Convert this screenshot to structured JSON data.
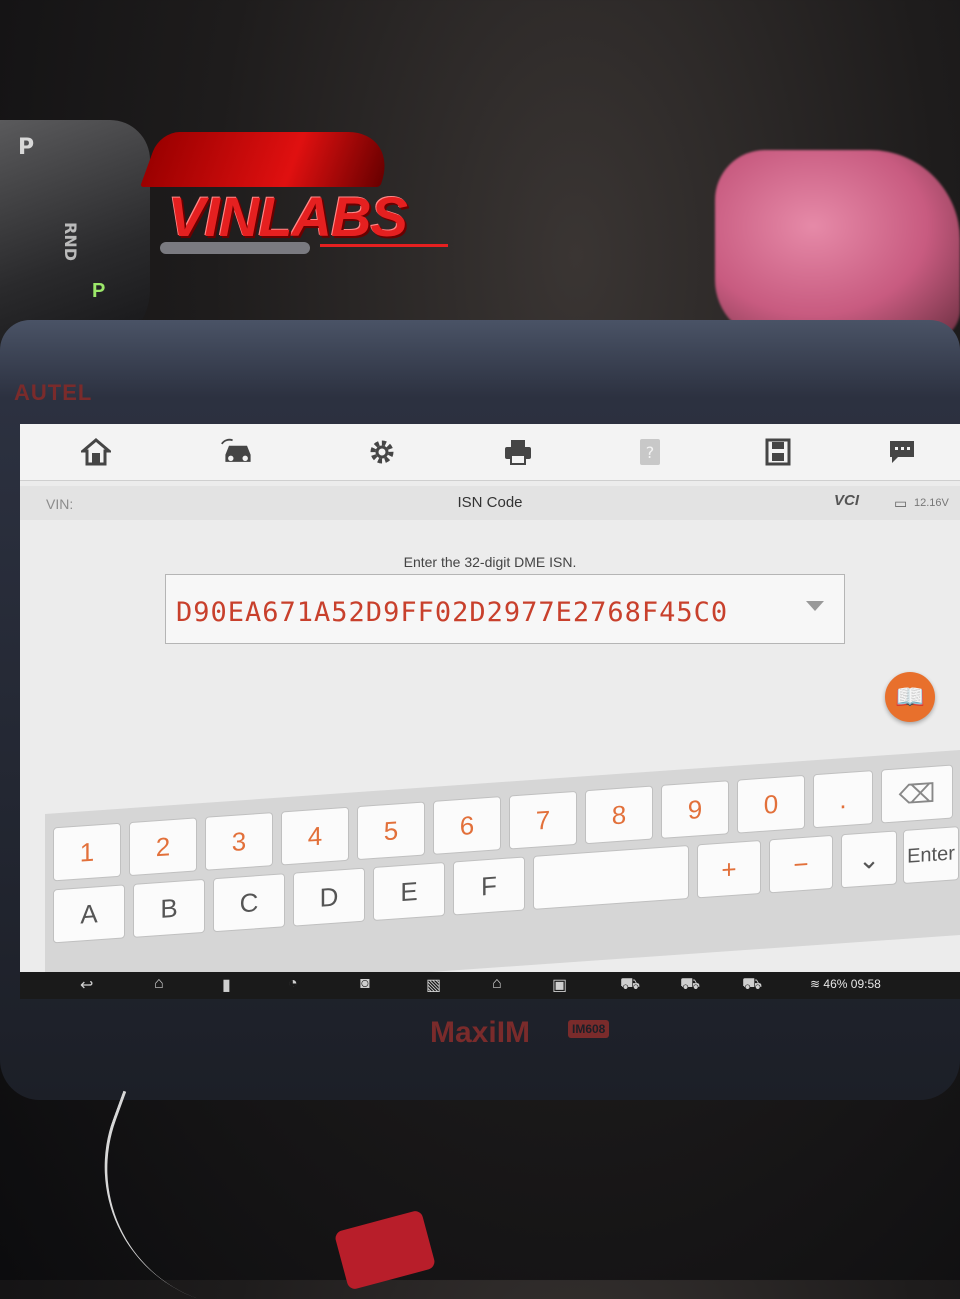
{
  "app": {
    "brand": "AUTEL",
    "model": "MaxiIM",
    "model_badge": "IM608",
    "watermark": "VINLABS",
    "gear_indicator": "P",
    "gear_letters": "RND",
    "gear_selected": "P"
  },
  "toolbar": {
    "items": [
      {
        "name": "home-icon",
        "glyph": "⌂"
      },
      {
        "name": "vehicle-swap-icon",
        "glyph": "⇄"
      },
      {
        "name": "settings-icon",
        "glyph": "⚙"
      },
      {
        "name": "print-icon",
        "glyph": "🖶"
      },
      {
        "name": "help-icon",
        "glyph": "?"
      },
      {
        "name": "save-icon",
        "glyph": "▤"
      },
      {
        "name": "feedback-icon",
        "glyph": "▭"
      }
    ]
  },
  "subheader": {
    "vin_label": "VIN:",
    "title": "ISN Code",
    "vci_label": "VCI",
    "voltage": "12.16V"
  },
  "form": {
    "prompt": "Enter the 32-digit DME ISN.",
    "isn_value": "D90EA671A52D9FF02D2977E2768F45C0"
  },
  "keyboard": {
    "row1": [
      "1",
      "2",
      "3",
      "4",
      "5",
      "6",
      "7",
      "8",
      "9",
      "0",
      ".",
      "⌫"
    ],
    "row2": [
      "A",
      "B",
      "C",
      "D",
      "E",
      "F",
      "",
      "+",
      "−",
      "⌄",
      "Enter"
    ]
  },
  "navbar": {
    "battery": "46%",
    "time": "09:58"
  },
  "colors": {
    "accent": "#e8702c",
    "isn_text": "#c8402c",
    "vci_green": "#3a9a3a"
  }
}
